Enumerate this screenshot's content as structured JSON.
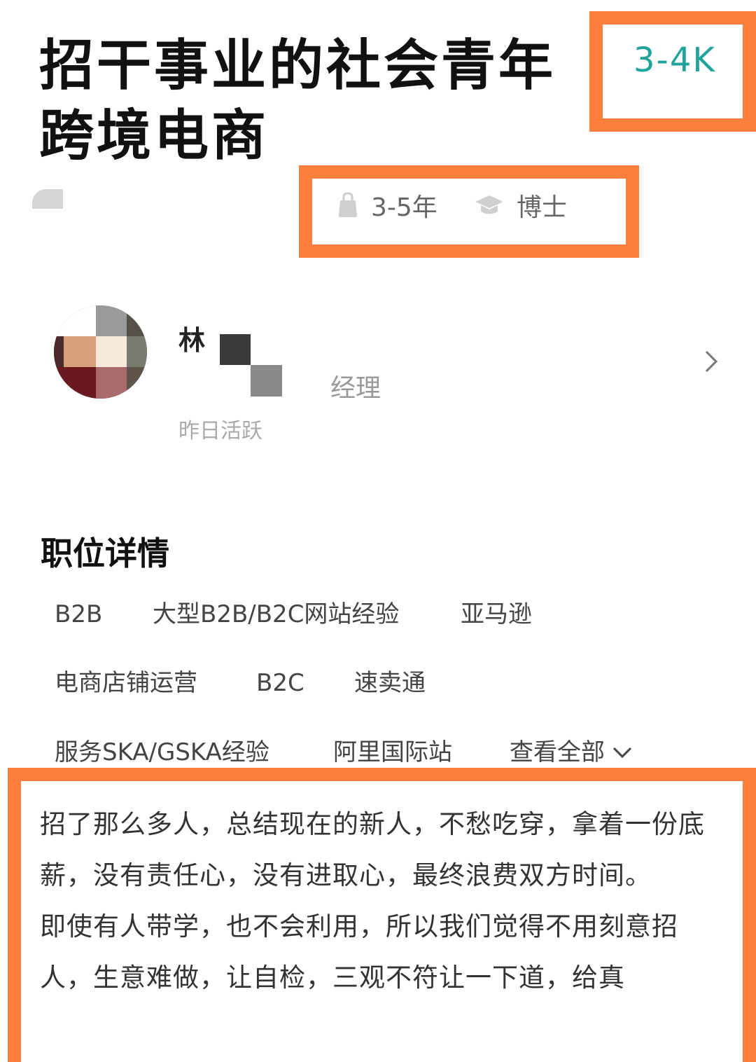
{
  "job": {
    "title": "招干事业的社会青年跨境电商",
    "salary": "3-4K",
    "experience": "3-5年",
    "education": "博士"
  },
  "recruiter": {
    "name": "林",
    "role": "经理",
    "status": "昨日活跃"
  },
  "details": {
    "section_title": "职位详情",
    "tags": [
      "B2B",
      "大型B2B/B2C网站经验",
      "亚马逊",
      "电商店铺运营",
      "B2C",
      "速卖通",
      "服务SKA/GSKA经验",
      "阿里国际站"
    ],
    "view_all_label": "查看全部"
  },
  "description": {
    "paragraph1": "招了那么多人，总结现在的新人，不愁吃穿，拿着一份底薪，没有责任心，没有进取心，最终浪费双方时间。",
    "paragraph2": "即使有人带学，也不会利用，所以我们觉得不用刻意招人，生意难做，让自检，三观不符让一下道，给真"
  },
  "icons": {
    "experience": "briefcase-icon",
    "education": "graduation-cap-icon",
    "chevron": "chevron-right-icon",
    "expand": "chevron-down-icon"
  },
  "colors": {
    "highlight_border": "#ff7f3e",
    "salary": "#1fa39a"
  }
}
